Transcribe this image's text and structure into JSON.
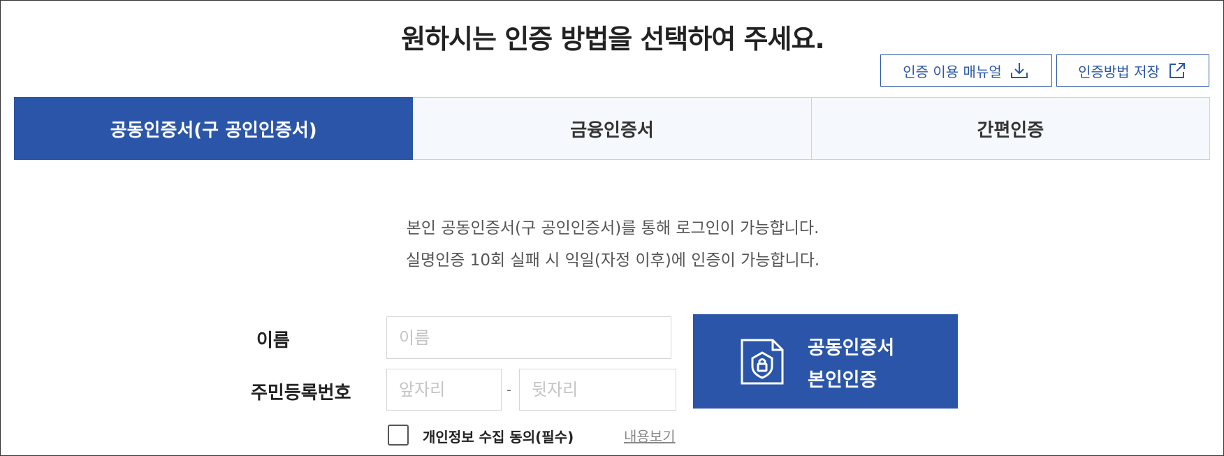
{
  "page": {
    "title": "원하시는 인증 방법을 선택하여 주세요."
  },
  "toolbar": {
    "manual_label": "인증 이용 매뉴얼",
    "manual_icon": "download-icon",
    "save_label": "인증방법 저장",
    "save_icon": "external-link-icon"
  },
  "tabs": [
    {
      "label": "공동인증서(구 공인인증서)",
      "active": true
    },
    {
      "label": "금융인증서",
      "active": false
    },
    {
      "label": "간편인증",
      "active": false
    }
  ],
  "description": {
    "line1": "본인 공동인증서(구 공인인증서)를 통해 로그인이 가능합니다.",
    "line2": "실명인증 10회 실패 시 익일(자정 이후)에 인증이 가능합니다."
  },
  "form": {
    "name_label": "이름",
    "name_placeholder": "이름",
    "name_value": "",
    "rrn_label": "주민등록번호",
    "rrn_front_placeholder": "앞자리",
    "rrn_back_placeholder": "뒷자리",
    "rrn_separator": "-",
    "consent_label": "개인정보 수집 동의(필수)",
    "consent_checked": false,
    "view_link": "내용보기"
  },
  "cert_button": {
    "line1": "공동인증서",
    "line2": "본인인증",
    "icon": "certificate-lock-icon"
  },
  "colors": {
    "primary": "#2a55a8",
    "tab_inactive_bg": "#f5f9fd",
    "tab_border": "#b7d9ea"
  }
}
